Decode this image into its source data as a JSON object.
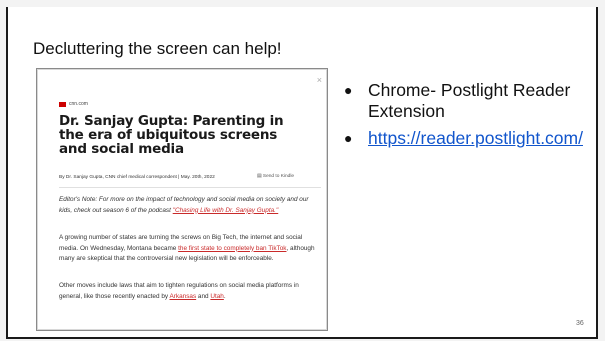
{
  "slide": {
    "title": "Decluttering the screen can help!",
    "page_number": "36"
  },
  "screenshot": {
    "close": "×",
    "source": "cnn.com",
    "headline": "Dr. Sanjay Gupta: Parenting in the era of ubiquitous screens and social media",
    "byline": "By Dr. Sanjay Gupta, CNN chief medical correspondent  |  May. 20th, 2022",
    "send_to_kindle": "Send to Kindle",
    "p1_text": "Editor's Note: For more on the impact of technology and social media on society and our kids, check out season 6 of the podcast ",
    "p1_link": "\"Chasing Life with Dr. Sanjay Gupta.\"",
    "p2_text_a": "A growing number of states are turning the screws on Big Tech, the internet and social media. On Wednesday, Montana became ",
    "p2_link": "the first state to completely ban TikTok",
    "p2_text_b": ", although many are skeptical that the controversial new legislation will be enforceable.",
    "p3_text_a": "Other moves include laws that aim to tighten regulations on social media platforms in general, like those recently enacted by ",
    "p3_link_1": "Arkansas",
    "p3_and": " and ",
    "p3_link_2": "Utah",
    "p3_end": "."
  },
  "bullets": [
    {
      "text": "Chrome- Postlight Reader Extension"
    },
    {
      "text": "https://reader.postlight.com/"
    }
  ],
  "colors": {
    "link": "#1155cc",
    "article_link": "#c92a2a",
    "cnn_red": "#cc0000"
  }
}
